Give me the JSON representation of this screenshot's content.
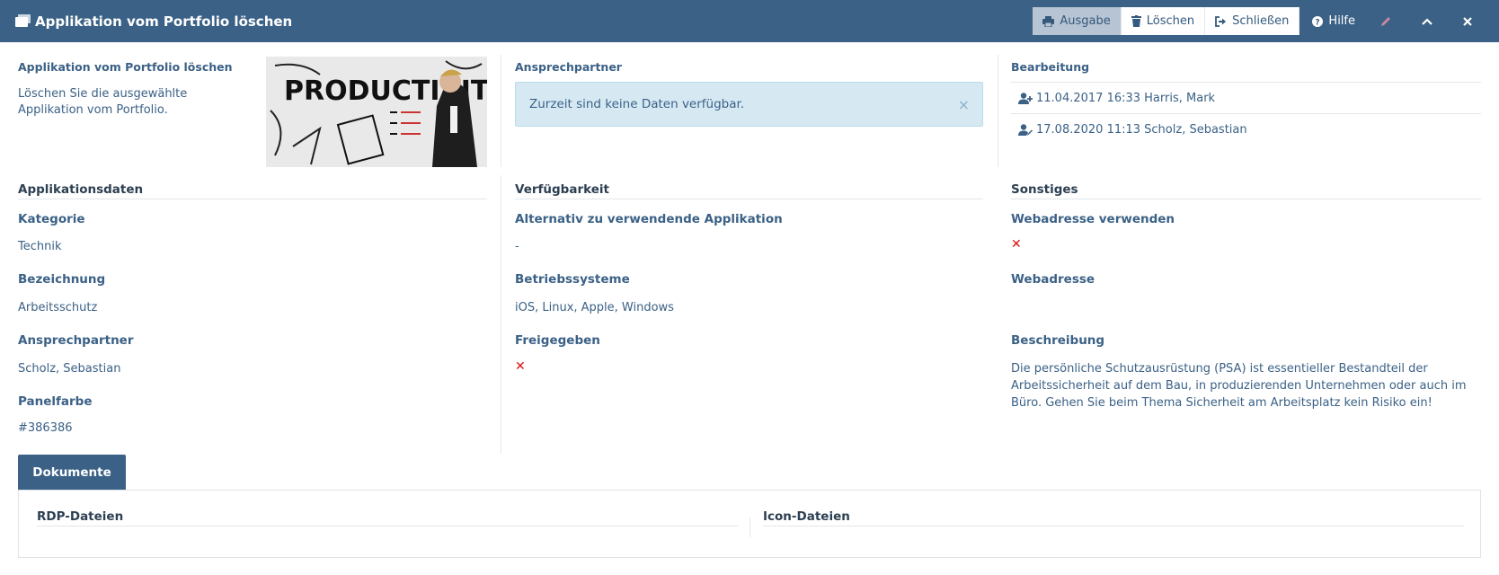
{
  "header": {
    "title": "Applikation vom Portfolio löschen",
    "buttons": {
      "print": "Ausgabe",
      "delete": "Löschen",
      "close": "Schließen",
      "help": "Hilfe"
    }
  },
  "intro": {
    "heading": "Applikation vom Portfolio löschen",
    "text": "Löschen Sie die ausgewählte Applikation vom Portfolio."
  },
  "contact": {
    "heading": "Ansprechpartner",
    "alert": "Zurzeit sind keine Daten verfügbar.",
    "alert_close": "×"
  },
  "editing": {
    "heading": "Bearbeitung",
    "entries": [
      "11.04.2017 16:33 Harris, Mark",
      "17.08.2020 11:13 Scholz, Sebastian"
    ]
  },
  "app_data": {
    "title": "Applikationsdaten",
    "category_label": "Kategorie",
    "category_value": "Technik",
    "name_label": "Bezeichnung",
    "name_value": "Arbeitsschutz",
    "contact_label": "Ansprechpartner",
    "contact_value": "Scholz, Sebastian",
    "color_label": "Panelfarbe",
    "color_value": "#386386"
  },
  "availability": {
    "title": "Verfügbarkeit",
    "alt_label": "Alternativ zu verwendende Applikation",
    "alt_value": "-",
    "os_label": "Betriebssysteme",
    "os_value": "iOS, Linux, Apple, Windows",
    "released_label": "Freigegeben",
    "released_mark": "✕"
  },
  "misc": {
    "title": "Sonstiges",
    "use_web_label": "Webadresse verwenden",
    "use_web_mark": "✕",
    "web_label": "Webadresse",
    "desc_label": "Beschreibung",
    "desc_value": "Die persönliche Schutzausrüstung (PSA) ist essentieller Bestandteil der Arbeitssicherheit auf dem Bau, in produzierenden Unternehmen oder auch im Büro. Gehen Sie beim Thema Sicherheit am Arbeitsplatz kein Risiko ein!"
  },
  "tabs": {
    "documents": "Dokumente"
  },
  "documents": {
    "rdp_title": "RDP-Dateien",
    "icon_title": "Icon-Dateien"
  },
  "photo": {
    "wall_text": "PRODUCTIVITY"
  },
  "colors": {
    "header_bg": "#3b6186",
    "accent": "#386386",
    "error": "#e01010",
    "alert_bg": "#d6e9f3"
  }
}
